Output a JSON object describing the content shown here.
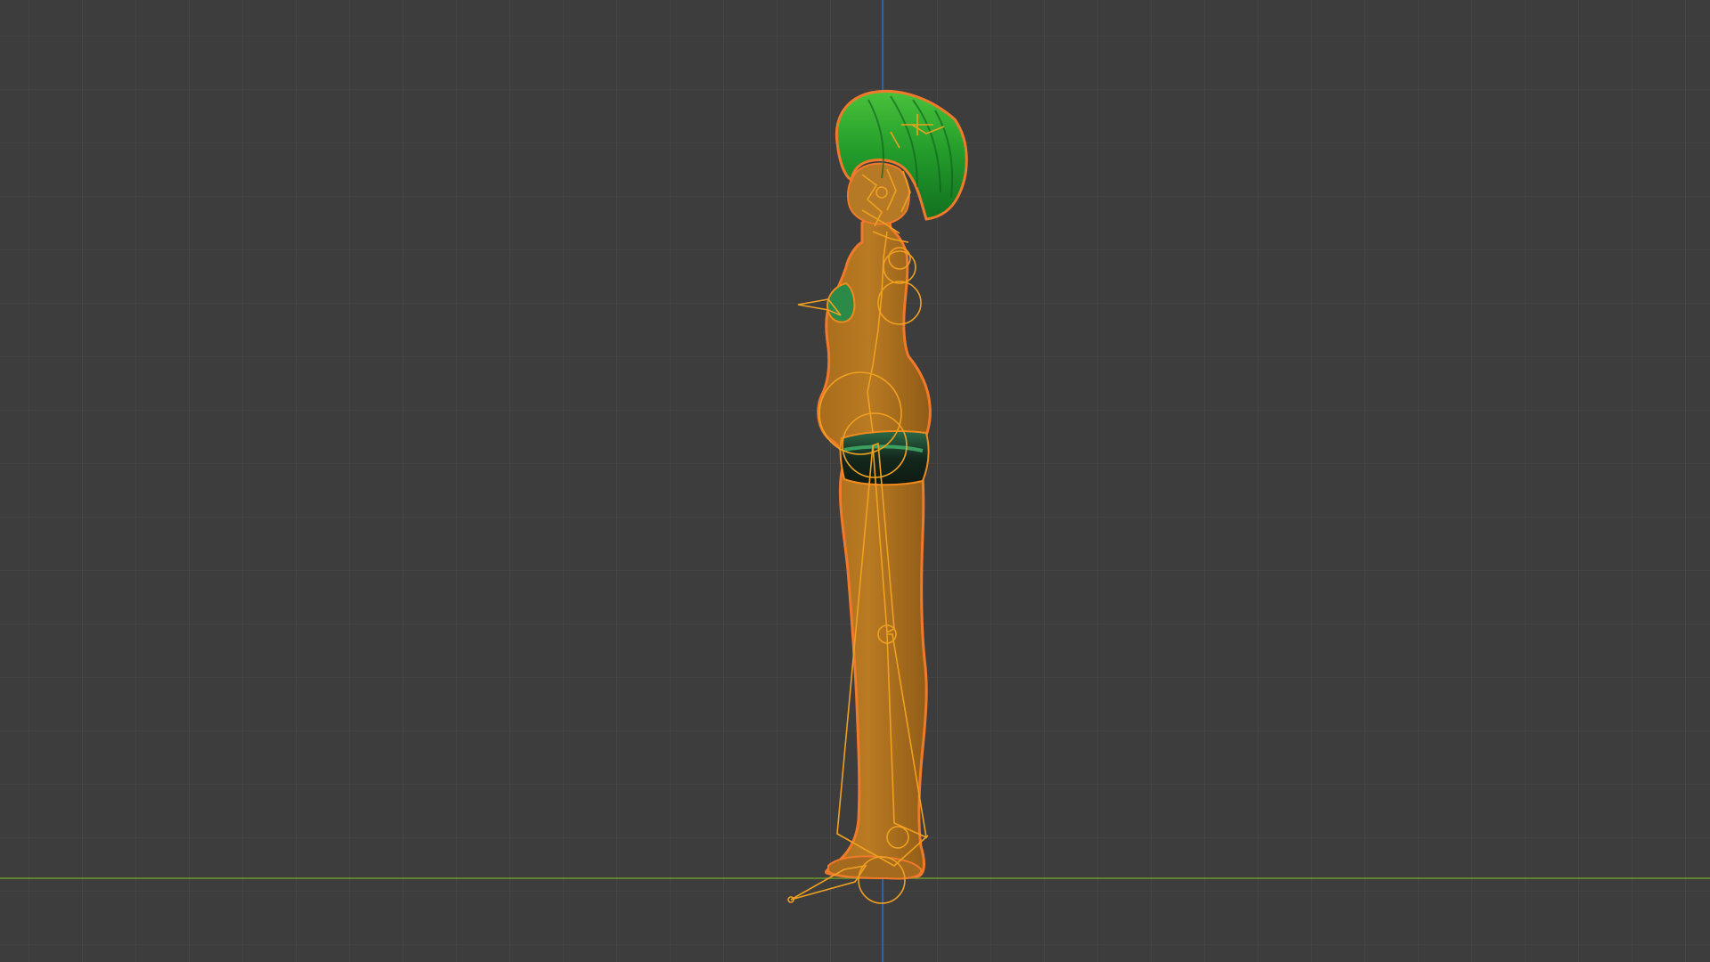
{
  "viewport": {
    "view": "side-orthographic",
    "background_color": "#3d3d3d",
    "grid": true,
    "grid_color": "#4a4a4a",
    "axis_x_color": "#6f9a2a",
    "axis_z_color": "#2f6fb3"
  },
  "scene": {
    "object": "character-mesh",
    "armature": "character-armature",
    "selection_outline_color": "#f08a1c",
    "hair_color": "#2a9a2a",
    "skin_color": "#b3741f",
    "clothing_color": "#1f4a34"
  }
}
